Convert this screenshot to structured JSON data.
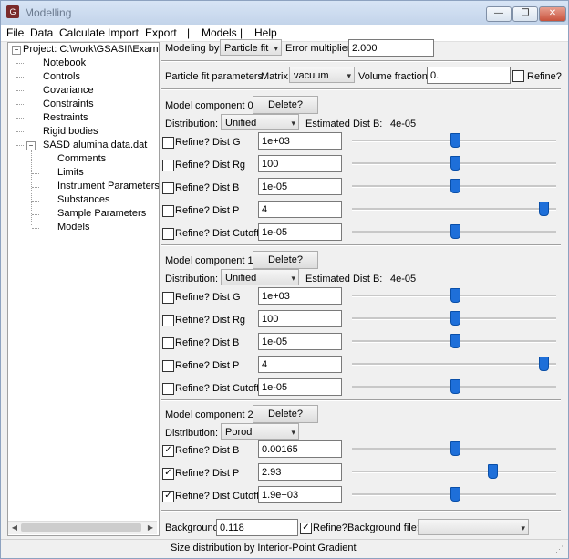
{
  "window": {
    "title": "Modelling",
    "app_icon": "gsas-icon",
    "minimize": "—",
    "maximize": "❐",
    "close": "✕"
  },
  "menu": [
    "File",
    "Data",
    "Calculate",
    "Import",
    "Export",
    "|",
    "Models",
    "|",
    "Help"
  ],
  "tree": {
    "project": "Project: C:\\work\\GSASII\\Exampl",
    "items": [
      "Notebook",
      "Controls",
      "Covariance",
      "Constraints",
      "Restraints",
      "Rigid bodies"
    ],
    "sasd": "SASD alumina data.dat",
    "sasd_items": [
      "Comments",
      "Limits",
      "Instrument Parameters",
      "Substances",
      "Sample Parameters",
      "Models"
    ]
  },
  "top": {
    "modeling_by_label": "Modeling by:",
    "modeling_by_value": "Particle fit",
    "error_multiplier_label": "Error multiplier:",
    "error_multiplier_value": "2.000",
    "particle_fit_label": "Particle fit parameters:",
    "matrix_label": "Matrix:",
    "matrix_value": "vacuum",
    "volume_fraction_label": "Volume fraction:",
    "volume_fraction_value": "0.",
    "refine_label": "Refine?"
  },
  "components": [
    {
      "title": "Model component 0:",
      "delete": "Delete?",
      "distribution_label": "Distribution:",
      "distribution": "Unified",
      "estimated_label": "Estimated Dist B:",
      "estimated_value": "4e-05",
      "params": [
        {
          "label": "Refine? Dist G",
          "value": "1e+03",
          "checked": false,
          "slider": 0.5
        },
        {
          "label": "Refine? Dist Rg",
          "value": "100",
          "checked": false,
          "slider": 0.5
        },
        {
          "label": "Refine? Dist B",
          "value": "1e-05",
          "checked": false,
          "slider": 0.5
        },
        {
          "label": "Refine? Dist P",
          "value": "4",
          "checked": false,
          "slider": 0.94
        },
        {
          "label": "Refine? Dist Cutoff",
          "value": "1e-05",
          "checked": false,
          "slider": 0.5
        }
      ]
    },
    {
      "title": "Model component 1:",
      "delete": "Delete?",
      "distribution_label": "Distribution:",
      "distribution": "Unified",
      "estimated_label": "Estimated Dist B:",
      "estimated_value": "4e-05",
      "params": [
        {
          "label": "Refine? Dist G",
          "value": "1e+03",
          "checked": false,
          "slider": 0.5
        },
        {
          "label": "Refine? Dist Rg",
          "value": "100",
          "checked": false,
          "slider": 0.5
        },
        {
          "label": "Refine? Dist B",
          "value": "1e-05",
          "checked": false,
          "slider": 0.5
        },
        {
          "label": "Refine? Dist P",
          "value": "4",
          "checked": false,
          "slider": 0.94
        },
        {
          "label": "Refine? Dist Cutoff",
          "value": "1e-05",
          "checked": false,
          "slider": 0.5
        }
      ]
    },
    {
      "title": "Model component 2:",
      "delete": "Delete?",
      "distribution_label": "Distribution:",
      "distribution": "Porod",
      "params": [
        {
          "label": "Refine? Dist B",
          "value": "0.00165",
          "checked": true,
          "slider": 0.5
        },
        {
          "label": "Refine? Dist P",
          "value": "2.93",
          "checked": true,
          "slider": 0.68
        },
        {
          "label": "Refine? Dist Cutoff",
          "value": "1.9e+03",
          "checked": true,
          "slider": 0.5
        }
      ]
    }
  ],
  "background": {
    "label": "Background:",
    "value": "0.118",
    "refine_label": "Refine?",
    "refine_checked": true,
    "file_label": "Background file:",
    "file_value": ""
  },
  "status": "Size distribution by Interior-Point Gradient",
  "colors": {
    "slider_thumb": "#1e6fd9",
    "title_bar": "#c3d4ea"
  }
}
